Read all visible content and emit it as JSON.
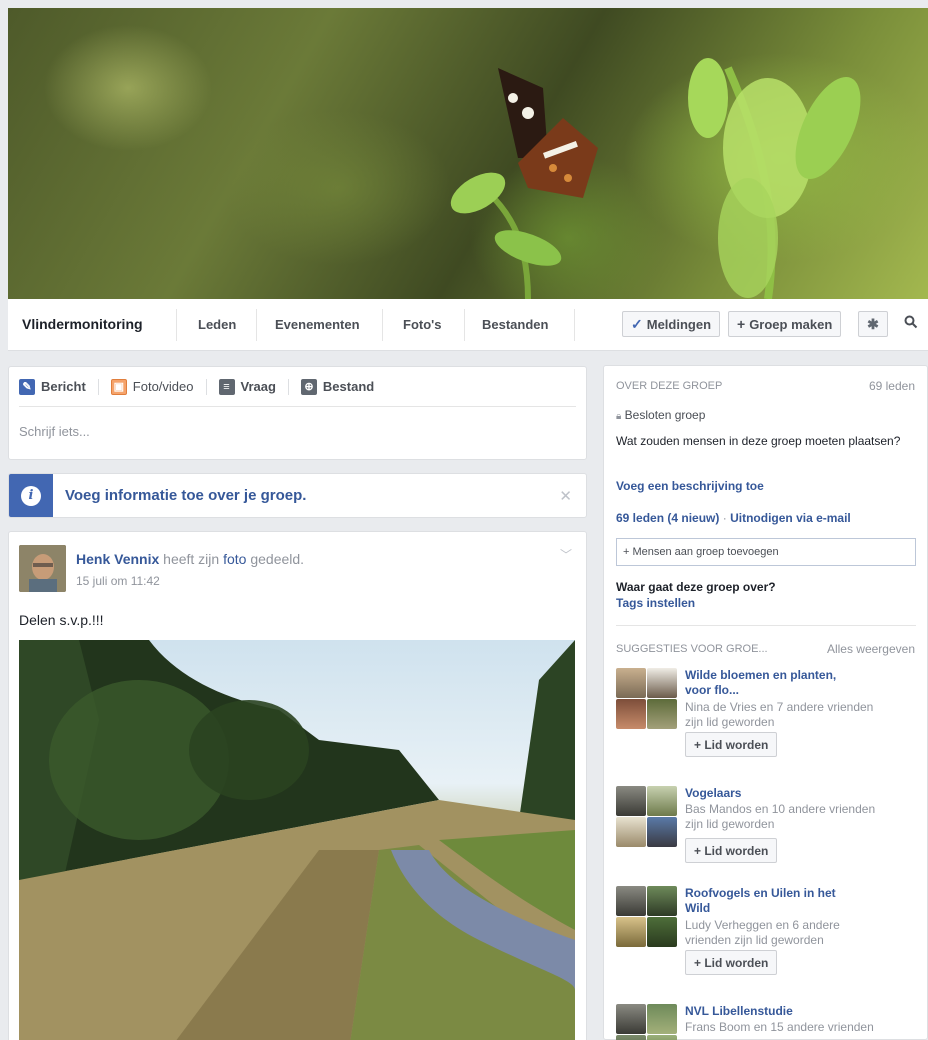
{
  "group": {
    "name": "Vlindermonitoring"
  },
  "nav": {
    "tabs": [
      "Leden",
      "Evenementen",
      "Foto's",
      "Bestanden"
    ],
    "notifications_label": "Meldingen",
    "create_group_label": "Groep maken"
  },
  "composer": {
    "tabs": [
      "Bericht",
      "Foto/video",
      "Vraag",
      "Bestand"
    ],
    "placeholder": "Schrijf iets..."
  },
  "info_banner": {
    "text": "Voeg informatie toe over je groep."
  },
  "post": {
    "author": "Henk Vennix",
    "action_prefix": "heeft zijn",
    "action_link": "foto",
    "action_suffix": "gedeeld.",
    "time": "15 juli om 11:42",
    "text": "Delen s.v.p.!!!"
  },
  "sidebar": {
    "about_heading": "OVER DEZE GROEP",
    "member_count": "69 leden",
    "privacy": "Besloten groep",
    "question": "Wat zouden mensen in deze groep moeten plaatsen?",
    "add_description": "Voeg een beschrijving toe",
    "members_line": "69 leden",
    "new_count": "(4 nieuw)",
    "invite": "Uitnodigen via e-mail",
    "add_people_placeholder": "+ Mensen aan groep toevoegen",
    "about_question": "Waar gaat deze groep over?",
    "set_tags": "Tags instellen",
    "suggestions_heading": "SUGGESTIES VOOR GROE...",
    "show_all": "Alles weergeven",
    "suggestions": [
      {
        "name_line1": "Wilde bloemen en planten,",
        "name_line2": "voor flo...",
        "meta_line1": "Nina de Vries en 7 andere vrienden",
        "meta_line2": "zijn lid geworden",
        "button": "Lid worden"
      },
      {
        "name_line1": "Vogelaars",
        "name_line2": "",
        "meta_line1": "Bas Mandos en 10 andere vrienden",
        "meta_line2": "zijn lid geworden",
        "button": "Lid worden"
      },
      {
        "name_line1": "Roofvogels en Uilen in het",
        "name_line2": "Wild",
        "meta_line1": "Ludy Verheggen en 6 andere",
        "meta_line2": "vrienden zijn lid geworden",
        "button": "Lid worden"
      },
      {
        "name_line1": "NVL Libellenstudie",
        "name_line2": "",
        "meta_line1": "Frans Boom en 15 andere vrienden",
        "meta_line2": "",
        "button": ""
      }
    ]
  },
  "colors": {
    "link": "#365899",
    "accent": "#4267b2",
    "background": "#e9ebee"
  }
}
